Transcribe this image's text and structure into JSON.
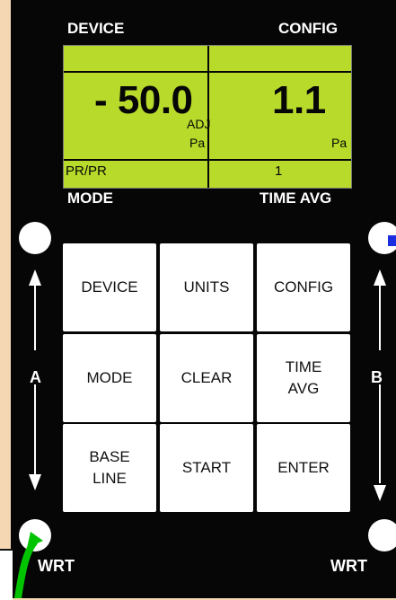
{
  "header": {
    "device_label": "DEVICE",
    "config_label": "CONFIG",
    "mode_label": "MODE",
    "time_avg_label": "TIME AVG"
  },
  "display": {
    "left_value": "- 50.0",
    "left_sub": "ADJ",
    "left_unit": "Pa",
    "right_value": "1.1",
    "right_unit": "Pa",
    "mode_value": "PR/PR",
    "time_avg_value": "1"
  },
  "keypad": {
    "keys": [
      "DEVICE",
      "UNITS",
      "CONFIG",
      "MODE",
      "CLEAR",
      "TIME\nAVG",
      "BASE\nLINE",
      "START",
      "ENTER"
    ]
  },
  "sides": {
    "left_label": "A",
    "right_label": "B",
    "left_wrt": "WRT",
    "right_wrt": "WRT"
  },
  "colors": {
    "lcd": "#b8da2a",
    "panel": "#060606",
    "background": "#f6d7b4",
    "accent_green": "#00c400",
    "accent_blue": "#1a2ee0"
  }
}
